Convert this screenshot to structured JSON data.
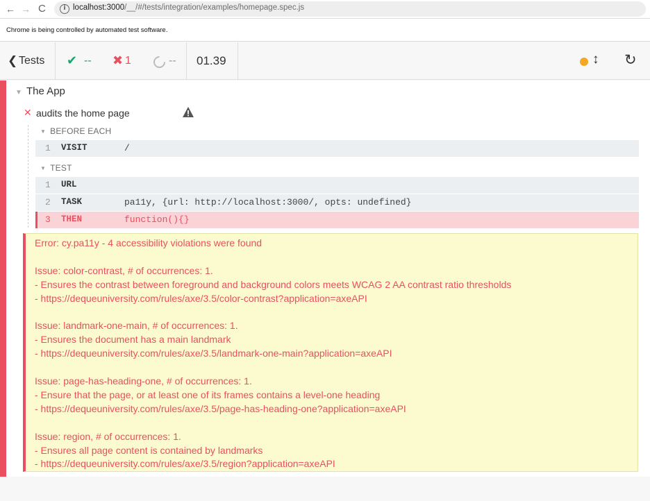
{
  "browser": {
    "nav_back": "←",
    "nav_forward": "→",
    "nav_reload": "C",
    "url_host": "localhost:3000",
    "url_path": "/__/#/tests/integration/examples/homepage.spec.js"
  },
  "automation_banner": "Chrome is being controlled by automated test software.",
  "header": {
    "tests_label": "Tests",
    "passed_count": "--",
    "failed_count": "1",
    "pending_count": "--",
    "duration": "01.39",
    "icons": {
      "back": "chevron-left-icon",
      "pass": "check-icon",
      "fail": "x-icon",
      "pending": "circle-notch-icon",
      "scroll": "scroll-arrows-icon",
      "restart": "restart-icon"
    },
    "colors": {
      "pass": "#1aa56f",
      "fail": "#e94f5f",
      "running_dot": "#f5a623"
    }
  },
  "reporter": {
    "suite_title": "The App",
    "test_title": "audits the home page",
    "hooks": [
      {
        "title": "BEFORE EACH",
        "commands": [
          {
            "num": "1",
            "name": "VISIT",
            "message": "/"
          }
        ]
      },
      {
        "title": "TEST",
        "commands": [
          {
            "num": "1",
            "name": "URL",
            "message": ""
          },
          {
            "num": "2",
            "name": "TASK",
            "message": "pa11y, {url: http://localhost:3000/, opts: undefined}"
          },
          {
            "num": "3",
            "name": "THEN",
            "message": "function(){}",
            "state": "failed"
          }
        ]
      }
    ],
    "error_lines": [
      "Error: cy.pa11y - 4 accessibility violations were found",
      "",
      "Issue: color-contrast, # of occurrences: 1.",
      "- Ensures the contrast between foreground and background colors meets WCAG 2 AA contrast ratio thresholds",
      "- https://dequeuniversity.com/rules/axe/3.5/color-contrast?application=axeAPI",
      "",
      "Issue: landmark-one-main, # of occurrences: 1.",
      "- Ensures the document has a main landmark",
      "- https://dequeuniversity.com/rules/axe/3.5/landmark-one-main?application=axeAPI",
      "",
      "Issue: page-has-heading-one, # of occurrences: 1.",
      "- Ensure that the page, or at least one of its frames contains a level-one heading",
      "- https://dequeuniversity.com/rules/axe/3.5/page-has-heading-one?application=axeAPI",
      "",
      "Issue: region, # of occurrences: 1.",
      "- Ensures all page content is contained by landmarks",
      "- https://dequeuniversity.com/rules/axe/3.5/region?application=axeAPI"
    ]
  }
}
